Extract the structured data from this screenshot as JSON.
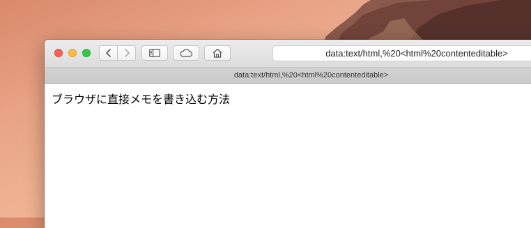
{
  "browser": {
    "address_text": "data:text/html,%20<html%20contenteditable>",
    "tab_title": "data:text/html,%20<html%20contenteditable>"
  },
  "page": {
    "content_text": "ブラウザに直接メモを書き込む方法"
  },
  "icons": [
    "back-icon",
    "forward-icon",
    "sidebar-icon",
    "cloud-icon",
    "home-icon"
  ],
  "colors": {
    "close": "#fc605c",
    "minimize": "#fdbc40",
    "maximize": "#34c84a"
  }
}
